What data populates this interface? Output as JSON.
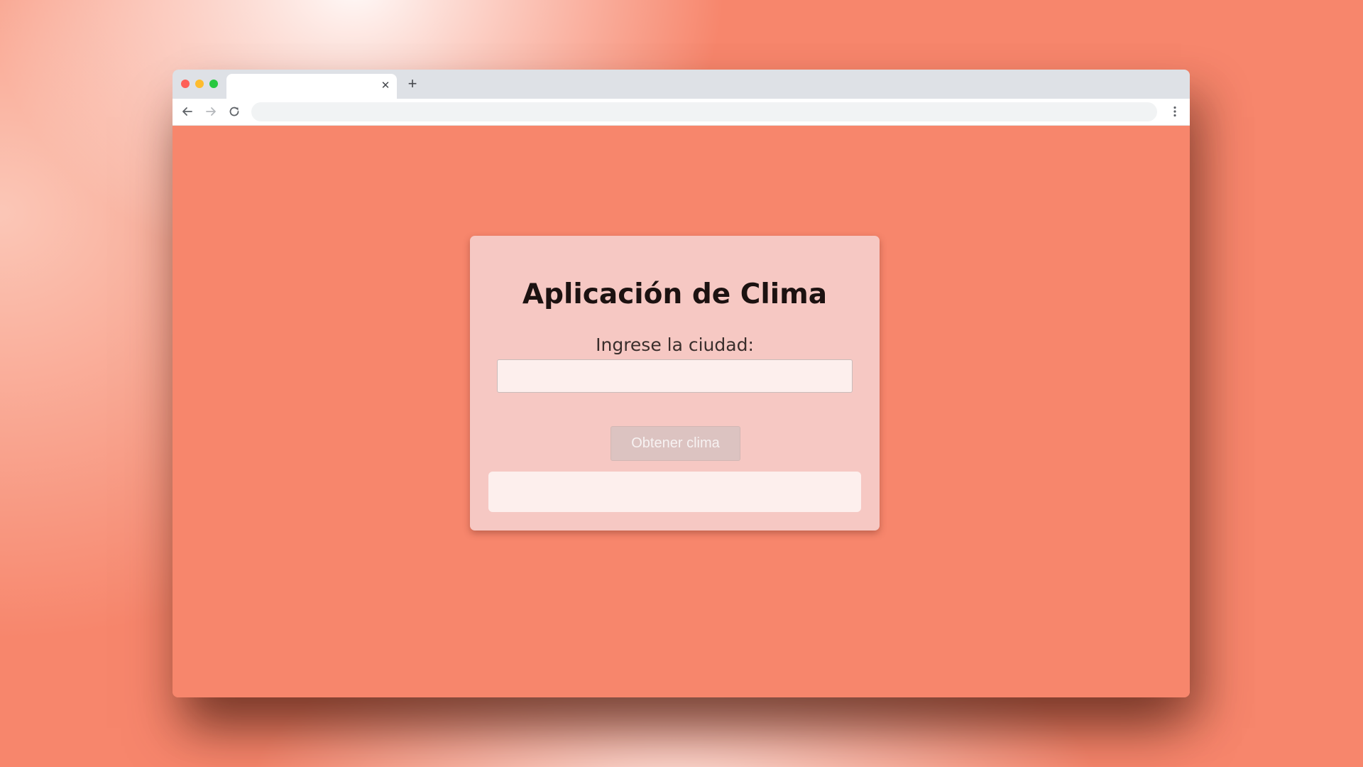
{
  "browser": {
    "tab": {
      "title": "",
      "close_icon": "close-icon"
    },
    "new_tab_icon": "plus-icon",
    "toolbar": {
      "back_icon": "arrow-left-icon",
      "forward_icon": "arrow-right-icon",
      "reload_icon": "reload-icon",
      "address": "",
      "menu_icon": "kebab-menu-icon"
    }
  },
  "app": {
    "title": "Aplicación de Clima",
    "city_label": "Ingrese la ciudad:",
    "city_input_value": "",
    "button_label": "Obtener clima",
    "result_text": ""
  },
  "colors": {
    "page_background": "#f7866c",
    "card_background": "#f6c8c3",
    "input_background": "#fdefed",
    "button_background": "#dcc3c1",
    "button_text": "#f7f2f2",
    "title_text": "#1c1211"
  }
}
